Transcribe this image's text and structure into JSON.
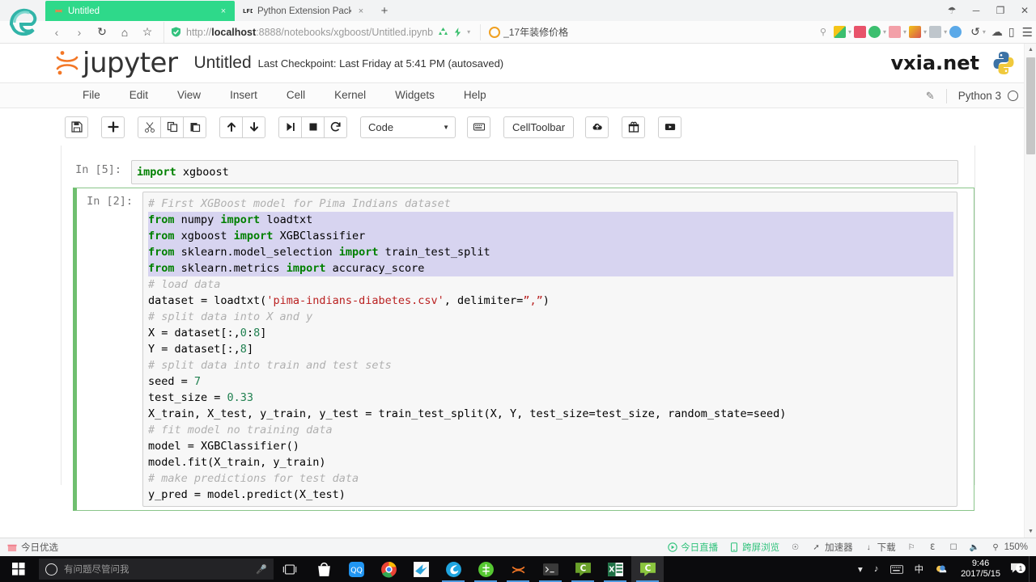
{
  "browser": {
    "tabs": [
      {
        "title": "Untitled",
        "favicon": "jupyter-favicon",
        "active": true,
        "close_label": "×"
      },
      {
        "title": "Python Extension Packages fo",
        "favicon": "lfd-favicon",
        "active": false,
        "close_label": "×"
      }
    ],
    "new_tab_label": "+",
    "window_controls": {
      "skin": "☂",
      "minimize": "─",
      "maximize": "❐",
      "close": "✕"
    },
    "nav": {
      "back": "‹",
      "forward": "›",
      "reload": "↻",
      "home": "⌂",
      "favorite": "☆"
    },
    "url": {
      "scheme": "http://",
      "host": "localhost",
      "rest": ":8888/notebooks/xgboost/Untitled.ipynb"
    },
    "search": {
      "text": "_17年装修价格",
      "icon": "search-icon"
    },
    "right_icons": [
      "undo-icon",
      "cloud-icon",
      "mobile-icon",
      "menu-icon"
    ]
  },
  "jupyter": {
    "logo_text": "jupyter",
    "notebook_title": "Untitled",
    "checkpoint": "Last Checkpoint: Last Friday at 5:41 PM (autosaved)",
    "watermark": "vxia.net",
    "menus": [
      "File",
      "Edit",
      "View",
      "Insert",
      "Cell",
      "Kernel",
      "Widgets",
      "Help"
    ],
    "edit_icon": "pencil-icon",
    "kernel_name": "Python 3",
    "kernel_status": "idle",
    "toolbar": {
      "save": "save-icon",
      "insert_below": "plus-icon",
      "cut": "scissors-icon",
      "copy": "copy-icon",
      "paste": "paste-icon",
      "move_up": "arrow-up-icon",
      "move_down": "arrow-down-icon",
      "run": "run-icon",
      "interrupt": "stop-icon",
      "restart": "restart-icon",
      "cell_type": "Code",
      "keyboard": "keyboard-icon",
      "cell_toolbar": "CellToolbar",
      "publish": "cloud-upload-icon",
      "gift": "gift-icon",
      "video": "video-icon"
    }
  },
  "notebook": {
    "cells": [
      {
        "prompt": "In [5]:",
        "selected": false,
        "lines": [
          [
            {
              "t": "import",
              "c": "k"
            },
            {
              "t": " xgboost",
              "c": "pl"
            }
          ]
        ]
      },
      {
        "prompt": "In [2]:",
        "selected": true,
        "lines": [
          [
            {
              "t": "# First XGBoost model for Pima Indians dataset",
              "c": "cm"
            }
          ],
          [
            {
              "t": "from",
              "c": "k"
            },
            {
              "t": " numpy ",
              "c": "pl"
            },
            {
              "t": "import",
              "c": "k"
            },
            {
              "t": " loadtxt",
              "c": "pl"
            }
          ],
          [
            {
              "t": "from",
              "c": "k"
            },
            {
              "t": " xgboost ",
              "c": "pl"
            },
            {
              "t": "import",
              "c": "k"
            },
            {
              "t": " XGBClassifier",
              "c": "pl"
            }
          ],
          [
            {
              "t": "from",
              "c": "k"
            },
            {
              "t": " sklearn.model_selection ",
              "c": "pl"
            },
            {
              "t": "import",
              "c": "k"
            },
            {
              "t": " train_test_split",
              "c": "pl"
            }
          ],
          [
            {
              "t": "from",
              "c": "k"
            },
            {
              "t": " sklearn.metrics ",
              "c": "pl"
            },
            {
              "t": "import",
              "c": "k"
            },
            {
              "t": " accuracy_score",
              "c": "pl"
            }
          ],
          [
            {
              "t": "# load data",
              "c": "cm"
            }
          ],
          [
            {
              "t": "dataset = loadtxt(",
              "c": "pl"
            },
            {
              "t": "'pima-indians-diabetes.csv'",
              "c": "st"
            },
            {
              "t": ", delimiter=",
              "c": "pl"
            },
            {
              "t": "”,”",
              "c": "st"
            },
            {
              "t": ")",
              "c": "pl"
            }
          ],
          [
            {
              "t": "# split data into X and y",
              "c": "cm"
            }
          ],
          [
            {
              "t": "X = dataset[:,",
              "c": "pl"
            },
            {
              "t": "0",
              "c": "nu"
            },
            {
              "t": ":",
              "c": "pl"
            },
            {
              "t": "8",
              "c": "nu"
            },
            {
              "t": "]",
              "c": "pl"
            }
          ],
          [
            {
              "t": "Y = dataset[:,",
              "c": "pl"
            },
            {
              "t": "8",
              "c": "nu"
            },
            {
              "t": "]",
              "c": "pl"
            }
          ],
          [
            {
              "t": "# split data into train and test sets",
              "c": "cm"
            }
          ],
          [
            {
              "t": "seed = ",
              "c": "pl"
            },
            {
              "t": "7",
              "c": "nu"
            }
          ],
          [
            {
              "t": "test_size = ",
              "c": "pl"
            },
            {
              "t": "0.33",
              "c": "nu"
            }
          ],
          [
            {
              "t": "X_train, X_test, y_train, y_test = train_test_split(X, Y, test_size=test_size, random_state=seed)",
              "c": "pl"
            }
          ],
          [
            {
              "t": "# fit model no training data",
              "c": "cm"
            }
          ],
          [
            {
              "t": "model = XGBClassifier()",
              "c": "pl"
            }
          ],
          [
            {
              "t": "model.fit(X_train, y_train)",
              "c": "pl"
            }
          ],
          [
            {
              "t": "# make predictions for test data",
              "c": "cm"
            }
          ],
          [
            {
              "t": "y_pred = model.predict(X_test)",
              "c": "pl"
            }
          ]
        ],
        "highlight_lines": [
          1,
          2,
          3,
          4
        ]
      }
    ]
  },
  "statusbar": {
    "left": {
      "label": "今日优选",
      "icon": "gift-icon"
    },
    "right": [
      {
        "label": "今日直播",
        "icon": "play-icon",
        "accent": true
      },
      {
        "label": "跨屏浏览",
        "icon": "phone-icon",
        "accent": true
      },
      {
        "label": "",
        "icon": "shield-icon",
        "accent": false
      },
      {
        "label": "加速器",
        "icon": "rocket-icon",
        "accent": false
      },
      {
        "label": "下载",
        "icon": "download-icon",
        "accent": false
      },
      {
        "label": "",
        "icon": "flag-icon",
        "accent": false
      },
      {
        "label": "",
        "icon": "edge-icon",
        "accent": false
      },
      {
        "label": "",
        "icon": "window-icon",
        "accent": false
      },
      {
        "label": "",
        "icon": "sound-icon",
        "accent": false
      },
      {
        "label": "150%",
        "icon": "zoom-icon",
        "accent": false
      }
    ]
  },
  "taskbar": {
    "start": "windows-start-icon",
    "cortana_placeholder": "有问题尽管问我",
    "cortana_mic": "microphone-icon",
    "task_view": "task-view-icon",
    "apps": [
      {
        "name": "microsoft-store-icon",
        "running": false,
        "active": false
      },
      {
        "name": "qq-icon",
        "running": false,
        "active": false
      },
      {
        "name": "chrome-icon",
        "running": false,
        "active": false
      },
      {
        "name": "bird-app-icon",
        "running": false,
        "active": false
      },
      {
        "name": "360-browser-icon",
        "running": true,
        "active": false
      },
      {
        "name": "green-circle-app-icon",
        "running": true,
        "active": false
      },
      {
        "name": "jupyter-icon",
        "running": true,
        "active": false
      },
      {
        "name": "console-icon",
        "running": true,
        "active": false
      },
      {
        "name": "camtasia-icon",
        "running": true,
        "active": false
      },
      {
        "name": "excel-icon",
        "running": true,
        "active": false
      },
      {
        "name": "camtasia-studio-icon",
        "running": true,
        "active": true
      }
    ],
    "tray": {
      "sound": "♪",
      "keyboard": "keyboard-icon",
      "ime": "中",
      "weather": "weather-icon"
    },
    "clock": {
      "time": "9:46",
      "date": "2017/5/15"
    },
    "notification": {
      "icon": "notification-icon",
      "count": "1"
    }
  }
}
